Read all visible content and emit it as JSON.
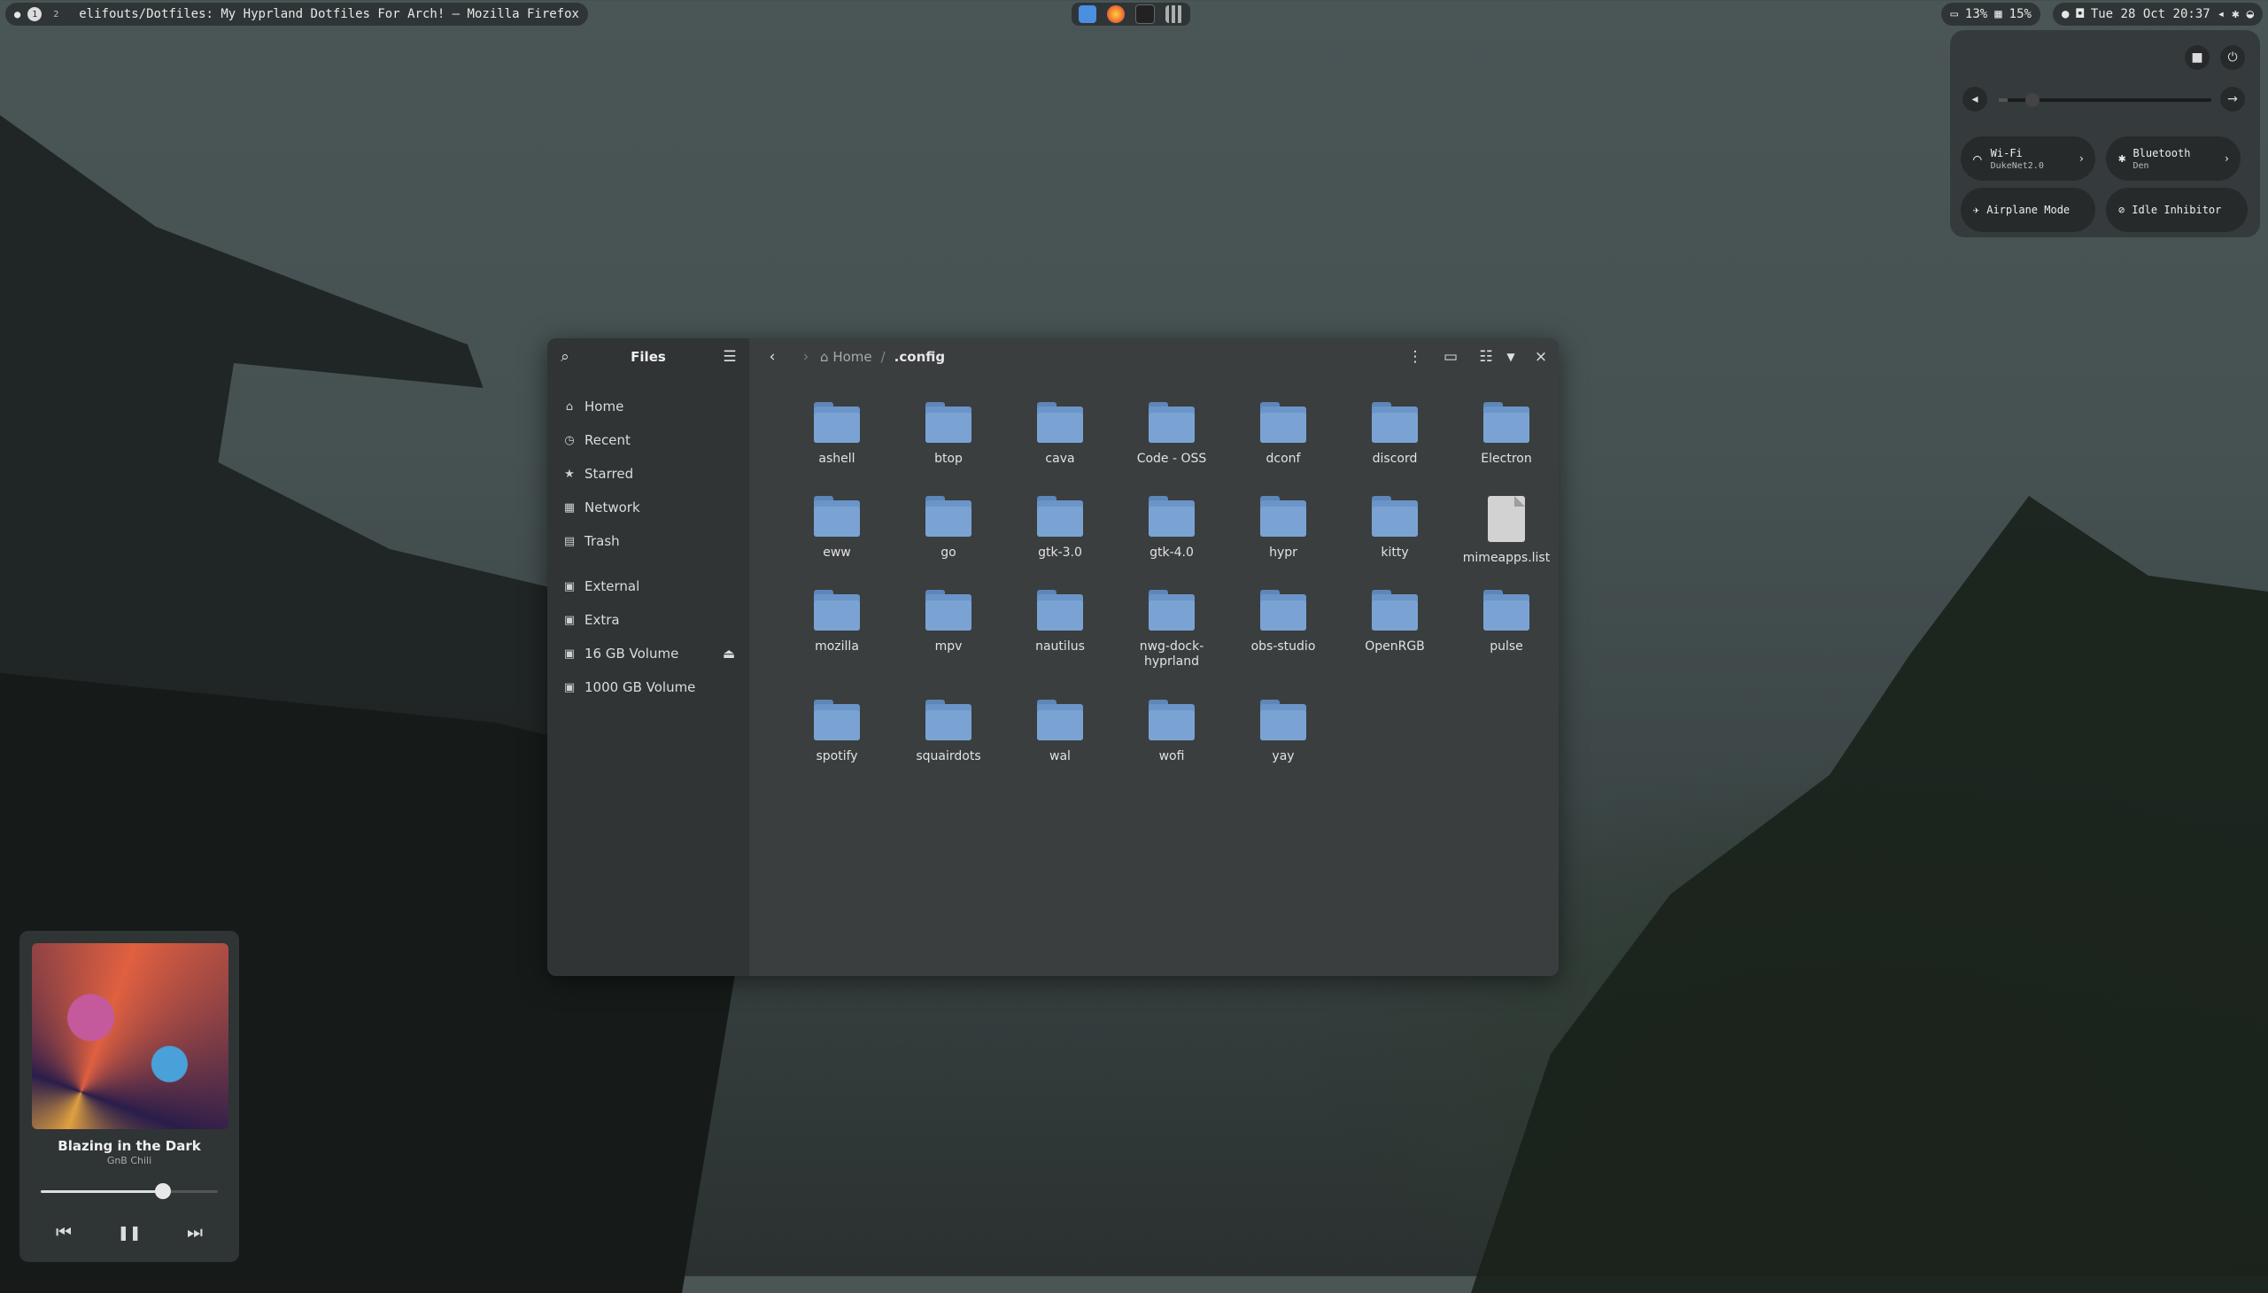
{
  "topbar": {
    "workspaces": [
      "1",
      "2"
    ],
    "window_title": "elifouts/Dotfiles: My Hyprland Dotfiles For Arch! — Mozilla Firefox",
    "stats": "13% 15%",
    "cpu": "13%",
    "mem": "15%",
    "datetime": "Tue 28 Oct 20:37"
  },
  "quick_settings": {
    "wifi_label": "Wi-Fi",
    "wifi_network": "DukeNet2.0",
    "bluetooth_label": "Bluetooth",
    "bluetooth_device": "Den",
    "airplane_label": "Airplane Mode",
    "idle_label": "Idle Inhibitor"
  },
  "files": {
    "title": "Files",
    "sidebar": [
      {
        "label": "Home",
        "icon": "home-icon"
      },
      {
        "label": "Recent",
        "icon": "clock-icon"
      },
      {
        "label": "Starred",
        "icon": "star-icon"
      },
      {
        "label": "Network",
        "icon": "network-icon"
      },
      {
        "label": "Trash",
        "icon": "trash-icon"
      },
      {
        "label": "External",
        "icon": "drive-icon"
      },
      {
        "label": "Extra",
        "icon": "drive-icon"
      },
      {
        "label": "16 GB Volume",
        "icon": "drive-icon"
      },
      {
        "label": "1000 GB Volume",
        "icon": "drive-icon"
      }
    ],
    "breadcrumb": {
      "home": "Home",
      "separator": "/",
      "current": ".config"
    },
    "items": [
      {
        "name": "ashell",
        "type": "folder"
      },
      {
        "name": "btop",
        "type": "folder"
      },
      {
        "name": "cava",
        "type": "folder"
      },
      {
        "name": "Code - OSS",
        "type": "folder"
      },
      {
        "name": "dconf",
        "type": "folder"
      },
      {
        "name": "discord",
        "type": "folder"
      },
      {
        "name": "Electron",
        "type": "folder"
      },
      {
        "name": "eww",
        "type": "folder"
      },
      {
        "name": "go",
        "type": "folder"
      },
      {
        "name": "gtk-3.0",
        "type": "folder"
      },
      {
        "name": "gtk-4.0",
        "type": "folder"
      },
      {
        "name": "hypr",
        "type": "folder"
      },
      {
        "name": "kitty",
        "type": "folder"
      },
      {
        "name": "mimeapps.list",
        "type": "file"
      },
      {
        "name": "mozilla",
        "type": "folder"
      },
      {
        "name": "mpv",
        "type": "folder"
      },
      {
        "name": "nautilus",
        "type": "folder"
      },
      {
        "name": "nwg-dock-hyprland",
        "type": "folder"
      },
      {
        "name": "obs-studio",
        "type": "folder"
      },
      {
        "name": "OpenRGB",
        "type": "folder"
      },
      {
        "name": "pulse",
        "type": "folder"
      },
      {
        "name": "spotify",
        "type": "folder"
      },
      {
        "name": "squairdots",
        "type": "folder"
      },
      {
        "name": "wal",
        "type": "folder"
      },
      {
        "name": "wofi",
        "type": "folder"
      },
      {
        "name": "yay",
        "type": "folder"
      }
    ]
  },
  "player": {
    "song": "Blazing in the Dark",
    "artist": "GnB Chili",
    "progress": 0.69
  }
}
